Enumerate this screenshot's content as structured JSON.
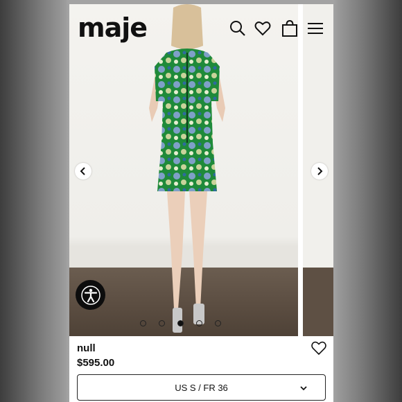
{
  "header": {
    "logo": "maje",
    "icons": [
      "search-icon",
      "heart-icon",
      "bag-icon",
      "menu-icon"
    ]
  },
  "gallery": {
    "slide_count": 5,
    "active_slide": 3
  },
  "product": {
    "name": "null",
    "price": "$595.00"
  },
  "size_select": {
    "label": "US S / FR 36"
  },
  "colors": {
    "text": "#111111",
    "dress_green": "#1f8a3a",
    "floor": "#5a4c40"
  }
}
